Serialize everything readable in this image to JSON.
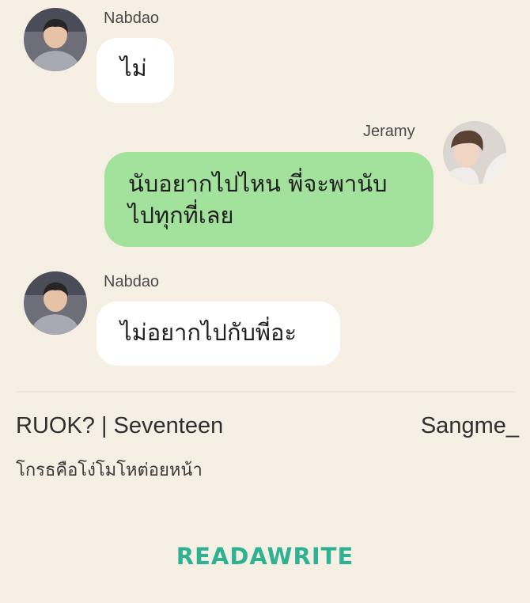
{
  "messages": [
    {
      "sender": "Nabdao",
      "direction": "incoming",
      "text": "ไม่"
    },
    {
      "sender": "Jeramy",
      "direction": "outgoing",
      "lines": [
        "นับอยากไปไหน พี่จะพานับ",
        "ไปทุกที่เลย"
      ]
    },
    {
      "sender": "Nabdao",
      "direction": "incoming",
      "text": "ไม่อยากไปกับพี่อะ"
    }
  ],
  "footer": {
    "story_title": "RUOK? | Seventeen",
    "author": "Sangme_",
    "chapter_title": "โกรธคือโง่โมโหต่อยหน้า"
  },
  "logo": {
    "text": "READAWRITE"
  },
  "colors": {
    "background": "#f6efe3",
    "incoming_bubble": "#ffffff",
    "outgoing_bubble": "#a3e29d",
    "logo": "#2fb293"
  },
  "icons": {
    "avatar_incoming": "profile-photo-nabdao",
    "avatar_outgoing": "profile-photo-jeramy"
  }
}
